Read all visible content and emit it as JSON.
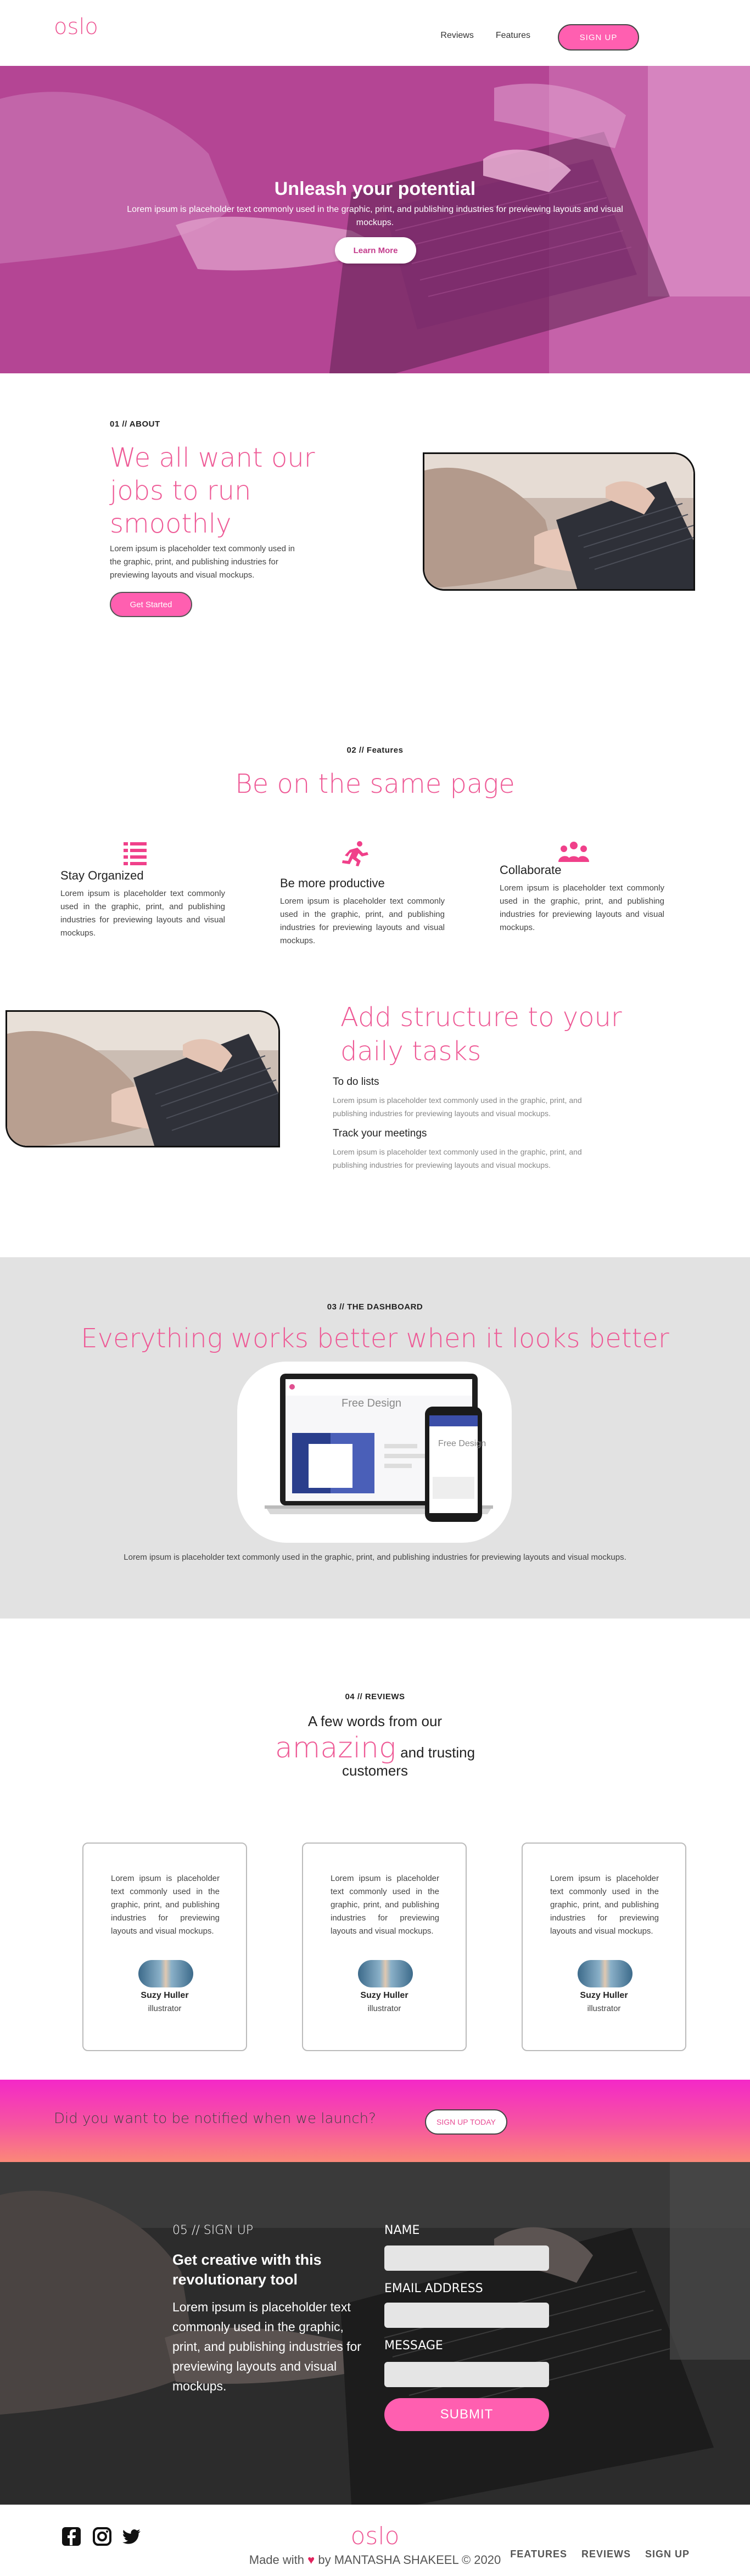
{
  "nav": {
    "logo": "oslo",
    "links": [
      "Reviews",
      "Features"
    ],
    "cta": "SIGN UP"
  },
  "hero": {
    "title": "Unleash your potential",
    "subtitle": "Lorem ipsum is placeholder text commonly used in the graphic, print, and publishing industries for previewing layouts and visual mockups.",
    "button": "Learn More"
  },
  "about": {
    "label": "01 // ABOUT",
    "title": "We all want our jobs to run smoothly",
    "text": "Lorem ipsum is placeholder text commonly used in the graphic, print, and publishing industries for previewing layouts and visual mockups.",
    "button": "Get Started"
  },
  "features": {
    "label": "02 // Features",
    "title": "Be on the same page",
    "items": [
      {
        "icon": "list-icon",
        "title": "Stay Organized",
        "text": "Lorem ipsum is placeholder text commonly used in the graphic, print, and publishing industries for previewing layouts and visual mockups."
      },
      {
        "icon": "running-icon",
        "title": "Be more productive",
        "text": "Lorem ipsum is placeholder text commonly used in the graphic, print, and publishing industries for previewing layouts and visual mockups."
      },
      {
        "icon": "team-icon",
        "title": "Collaborate",
        "text": "Lorem ipsum is placeholder text commonly used in the graphic, print, and publishing industries for previewing layouts and visual mockups."
      }
    ]
  },
  "structure": {
    "title": "Add structure to your daily tasks",
    "items": [
      {
        "title": "To do lists",
        "text": "Lorem ipsum is placeholder text commonly used in the graphic, print, and publishing industries for previewing layouts and visual mockups."
      },
      {
        "title": "Track your meetings",
        "text": "Lorem ipsum is placeholder text commonly used in the graphic, print, and publishing industries for previewing layouts and visual mockups."
      }
    ]
  },
  "dashboard": {
    "label": "03 // THE DASHBOARD",
    "title": "Everything works better when it looks better",
    "mockup_laptop_text": "Free Design",
    "mockup_phone_text": "Free Design",
    "text": "Lorem ipsum is placeholder text commonly used in the graphic, print, and publishing industries for previewing layouts and visual mockups."
  },
  "reviews": {
    "label": "04 // REVIEWS",
    "line1": "A few words from our",
    "highlight": "amazing",
    "line2": "and trusting",
    "line3": "customers",
    "cards": [
      {
        "text": "Lorem ipsum is placeholder text commonly used in the graphic, print, and publishing industries for previewing layouts and visual mockups.",
        "name": "Suzy Huller",
        "role": "illustrator"
      },
      {
        "text": "Lorem ipsum is placeholder text commonly used in the graphic, print, and publishing industries for previewing layouts and visual mockups.",
        "name": "Suzy Huller",
        "role": "illustrator"
      },
      {
        "text": "Lorem ipsum is placeholder text commonly used in the graphic, print, and publishing industries for previewing layouts and visual mockups.",
        "name": "Suzy Huller",
        "role": "illustrator"
      }
    ]
  },
  "notify": {
    "text": "Did you want to be notified when we launch?",
    "button": "SIGN UP TODAY"
  },
  "signup": {
    "label": "05 // SIGN UP",
    "title": "Get creative with this revolutionary tool",
    "text": "Lorem ipsum is placeholder text commonly used in the graphic, print, and publishing industries for previewing layouts and visual mockups.",
    "name_label": "NAME",
    "email_label": "EMAIL ADDRESS",
    "message_label": "MESSAGE",
    "submit": "SUBMIT"
  },
  "footer": {
    "logo": "oslo",
    "credit_pre": "Made with",
    "credit_post": "by MANTASHA SHAKEEL © 2020",
    "links": [
      "FEATURES",
      "REVIEWS",
      "SIGN UP"
    ],
    "social": [
      "facebook-icon",
      "instagram-icon",
      "twitter-icon"
    ]
  },
  "colors": {
    "accent": "#ee5a96",
    "button_pink": "#ff5fb0",
    "hero_overlay": "#b8479c",
    "dashboard_bg": "#e2e2e2",
    "signup_bg": "#2b2b2b"
  }
}
